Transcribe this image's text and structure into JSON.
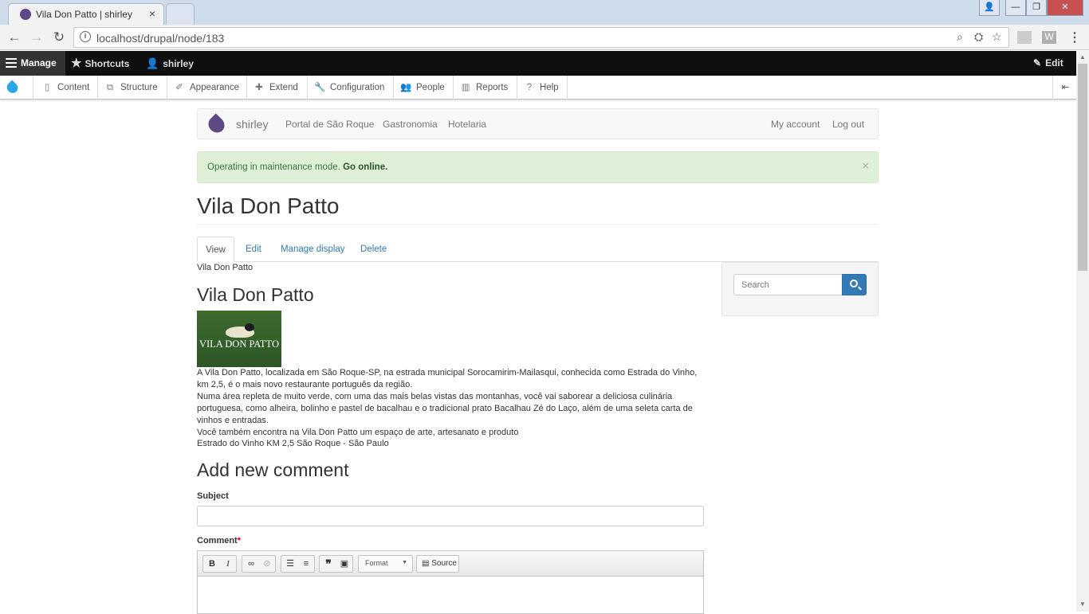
{
  "browser": {
    "tab_title": "Vila Don Patto | shirley",
    "tab_close": "×",
    "url": "localhost/drupal/node/183",
    "win_buttons": [
      "—",
      "❐",
      "✕"
    ]
  },
  "admin_bar": {
    "manage": "Manage",
    "shortcuts": "Shortcuts",
    "user": "shirley",
    "edit": "Edit"
  },
  "admin_tray": {
    "items": [
      "Content",
      "Structure",
      "Appearance",
      "Extend",
      "Configuration",
      "People",
      "Reports",
      "Help"
    ]
  },
  "site_nav": {
    "site_name": "shirley",
    "links": [
      "Portal de São Roque",
      "Gastronomia",
      "Hotelaria"
    ],
    "my_account": "My account",
    "log_out": "Log out"
  },
  "maintenance": {
    "text": "Operating in maintenance mode.",
    "link": "Go online.",
    "close": "×"
  },
  "page": {
    "title": "Vila Don Patto",
    "tabs": [
      "View",
      "Edit",
      "Manage display",
      "Delete"
    ]
  },
  "node": {
    "breadcrumb": "Vila Don Patto",
    "title": "Vila Don Patto",
    "image_text": "VILA DON PATTO",
    "paragraphs": [
      "A Vila Don Patto, localizada em São Roque-SP, na estrada municipal Sorocamirim-Mailasqui, conhecida como Estrada do Vinho, km 2,5, é o mais novo restaurante português da região.",
      "Numa área repleta de muito verde, com uma das mais belas vistas das montanhas, você vai saborear a deliciosa culinária portuguesa, como alheira, bolinho e pastel de bacalhau e o tradicional prato Bacalhau Zé do Laço, além de uma seleta carta de vinhos e entradas.",
      "Você também encontra na Vila Don Patto um espaço de arte, artesanato e produto"
    ],
    "address": "Estrado do Vinho KM 2,5 São Roque - São Paulo"
  },
  "comment_form": {
    "heading": "Add new comment",
    "subject_label": "Subject",
    "comment_label": "Comment",
    "required_mark": "*",
    "toolbar": {
      "bold": "B",
      "italic": "I",
      "format": "Format",
      "source": "Source"
    }
  },
  "sidebar": {
    "search_placeholder": "Search"
  }
}
